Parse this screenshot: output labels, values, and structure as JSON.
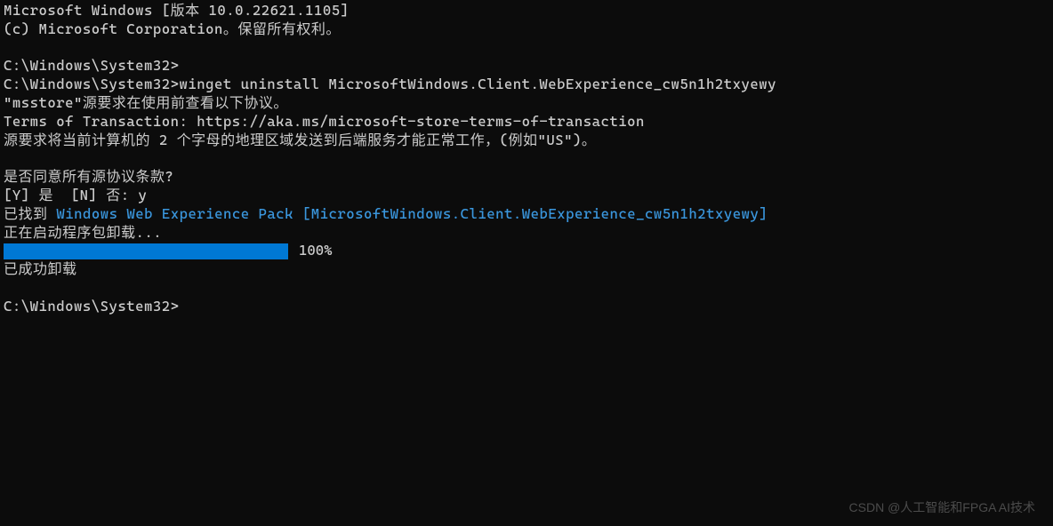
{
  "header": {
    "version_line": "Microsoft Windows [版本 10.0.22621.1105]",
    "copyright_line": "(c) Microsoft Corporation。保留所有权利。"
  },
  "session": {
    "prompt1": "C:\\Windows\\System32>",
    "prompt2_full": "C:\\Windows\\System32>winget uninstall MicrosoftWindows.Client.WebExperience_cw5n1h2txyewy",
    "msstore_notice": "\"msstore\"源要求在使用前查看以下协议。",
    "terms_line": "Terms of Transaction: https://aka.ms/microsoft-store-terms-of-transaction",
    "region_notice": "源要求将当前计算机的 2 个字母的地理区域发送到后端服务才能正常工作，(例如\"US\")。",
    "consent_question": "是否同意所有源协议条款?",
    "consent_options": "[Y] 是  [N] 否: y",
    "found_prefix": "已找到 ",
    "found_package": "Windows Web Experience Pack [MicrosoftWindows.Client.WebExperience_cw5n1h2txyewy]",
    "starting_uninstall": "正在启动程序包卸载...",
    "progress_percent": "100%",
    "success_message": "已成功卸载",
    "prompt3": "C:\\Windows\\System32>"
  },
  "watermark": "CSDN @人工智能和FPGA AI技术"
}
